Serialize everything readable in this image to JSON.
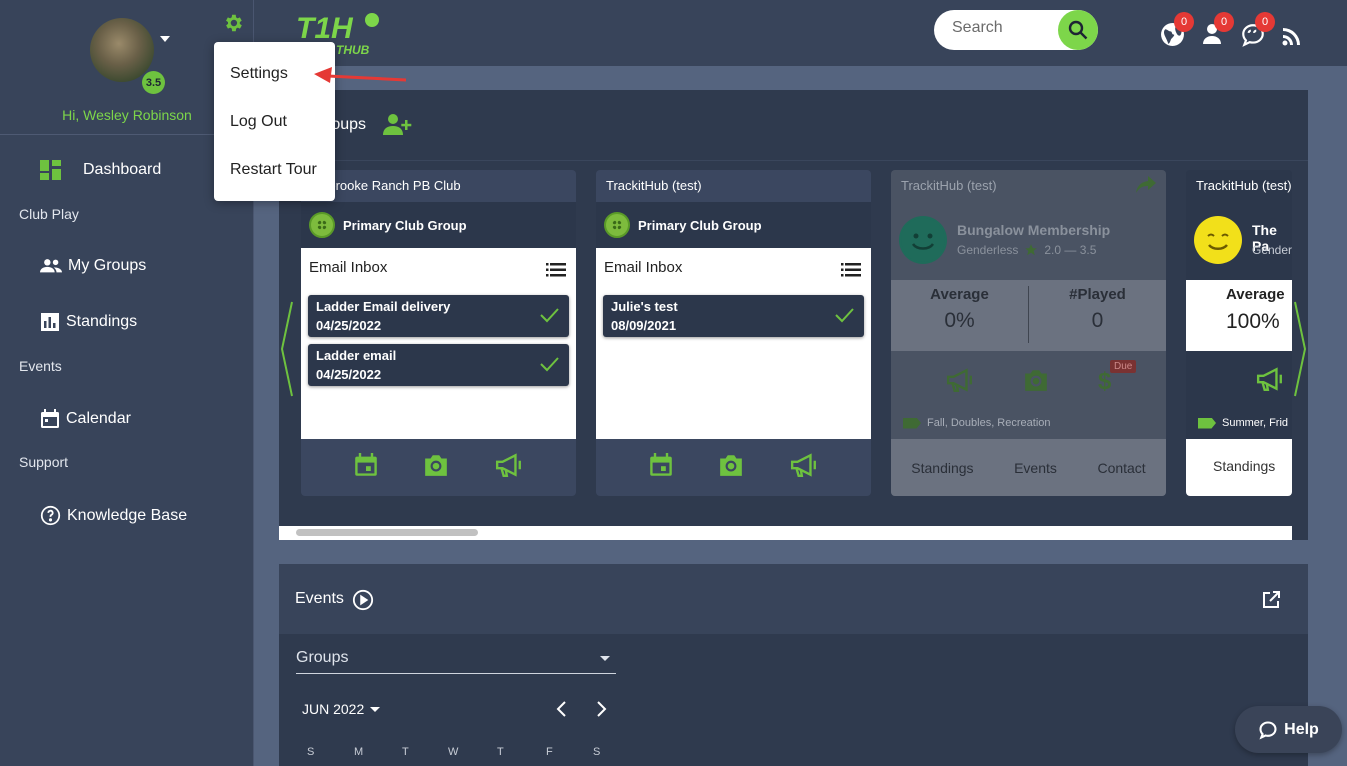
{
  "user": {
    "greeting": "Hi, Wesley Robinson",
    "rating": "3.5"
  },
  "user_menu": {
    "items": [
      "Settings",
      "Log Out",
      "Restart Tour"
    ]
  },
  "sidebar": {
    "items": [
      {
        "label": "Dashboard",
        "icon": "dashboard-icon"
      },
      {
        "label": "My Groups",
        "icon": "people-icon"
      },
      {
        "label": "Standings",
        "icon": "bar-chart-icon"
      },
      {
        "label": "Calendar",
        "icon": "calendar-icon"
      },
      {
        "label": "Knowledge Base",
        "icon": "help-circle-icon"
      }
    ],
    "sections": [
      "Club Play",
      "Events",
      "Support"
    ]
  },
  "header": {
    "logo_text": "T1H",
    "logo_sub": "THUB",
    "search_placeholder": "Search",
    "notifications": {
      "globe": "0",
      "user": "0",
      "chat": "0"
    }
  },
  "groups": {
    "title": "roups",
    "cards": [
      {
        "org": "dlebrooke Ranch PB Club",
        "group": "Primary Club Group",
        "inbox_title": "Email Inbox",
        "emails": [
          {
            "title": "Ladder Email delivery",
            "date": "04/25/2022"
          },
          {
            "title": "Ladder email",
            "date": "04/25/2022"
          }
        ]
      },
      {
        "org": "TrackitHub (test)",
        "group": "Primary Club Group",
        "inbox_title": "Email Inbox",
        "emails": [
          {
            "title": "Julie's test",
            "date": "08/09/2021"
          }
        ]
      },
      {
        "org": "TrackitHub (test)",
        "group": "Bungalow Membership",
        "gender": "Genderless",
        "rating_range": "2.0 — 3.5",
        "stats": {
          "average_label": "Average",
          "average": "0%",
          "played_label": "#Played",
          "played": "0"
        },
        "due_badge": "Due",
        "tags": "Fall, Doubles, Recreation",
        "links": [
          "Standings",
          "Events",
          "Contact"
        ]
      },
      {
        "org": "TrackitHub (test)",
        "group": "The Pa",
        "gender": "Gendere",
        "stats": {
          "average_label": "Average",
          "average": "100%"
        },
        "tags": "Summer, Frid",
        "links": [
          "Standings"
        ]
      }
    ]
  },
  "events": {
    "title": "Events",
    "groups_select": "Groups",
    "month": "JUN 2022",
    "weekdays": [
      "S",
      "M",
      "T",
      "W",
      "T",
      "F",
      "S"
    ]
  },
  "help": {
    "label": "Help"
  },
  "colors": {
    "accent": "#6ec23f",
    "sidebar": "#38445a",
    "panel": "#2f3a4e",
    "notif": "#e53935"
  }
}
